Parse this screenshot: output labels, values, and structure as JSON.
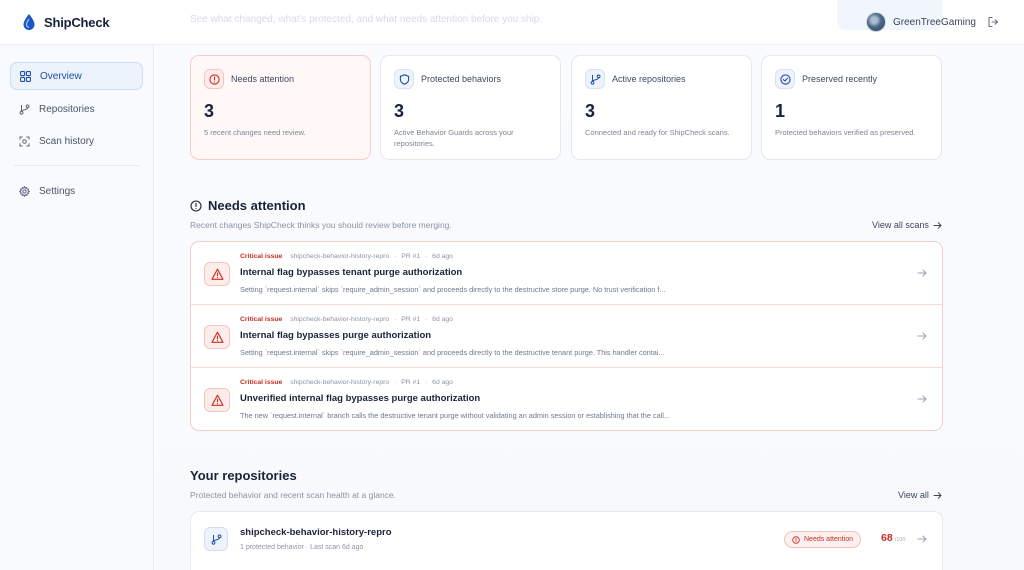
{
  "app": {
    "name": "ShipCheck"
  },
  "header": {
    "subtitle": "See what changed, what's protected, and what needs attention before you ship.",
    "username": "GreenTreeGaming"
  },
  "sidebar": {
    "items": [
      {
        "label": "Overview",
        "icon": "grid-icon",
        "active": true
      },
      {
        "label": "Repositories",
        "icon": "git-branch-icon",
        "active": false
      },
      {
        "label": "Scan history",
        "icon": "scan-icon",
        "active": false
      },
      {
        "label": "Settings",
        "icon": "gear-icon",
        "active": false
      }
    ]
  },
  "stats": [
    {
      "label": "Needs attention",
      "value": "3",
      "desc": "5 recent changes need review.",
      "icon": "alert-circle-icon"
    },
    {
      "label": "Protected behaviors",
      "value": "3",
      "desc": "Active Behavior Guards across your repositories.",
      "icon": "shield-icon"
    },
    {
      "label": "Active repositories",
      "value": "3",
      "desc": "Connected and ready for ShipCheck scans.",
      "icon": "git-branch-icon"
    },
    {
      "label": "Preserved recently",
      "value": "1",
      "desc": "Protected behaviors verified as preserved.",
      "icon": "check-circle-icon"
    }
  ],
  "attention": {
    "title": "Needs attention",
    "subtitle": "Recent changes ShipCheck thinks you should review before merging.",
    "link": "View all scans",
    "issues": [
      {
        "severity": "Critical issue",
        "repo": "shipcheck-behavior-history-repro",
        "pr": "PR #1",
        "time": "6d ago",
        "title": "Internal flag bypasses tenant purge authorization",
        "detail": "Setting `request.internal` skips `require_admin_session` and proceeds directly to the destructive store purge. No trust verification f..."
      },
      {
        "severity": "Critical issue",
        "repo": "shipcheck-behavior-history-repro",
        "pr": "PR #1",
        "time": "6d ago",
        "title": "Internal flag bypasses purge authorization",
        "detail": "Setting `request.internal` skips `require_admin_session` and proceeds directly to the destructive tenant purge. This handler contai..."
      },
      {
        "severity": "Critical issue",
        "repo": "shipcheck-behavior-history-repro",
        "pr": "PR #1",
        "time": "6d ago",
        "title": "Unverified internal flag bypasses purge authorization",
        "detail": "The new `request.internal` branch calls the destructive tenant purge without validating an admin session or establishing that the call..."
      }
    ]
  },
  "repositories": {
    "title": "Your repositories",
    "subtitle": "Protected behavior and recent scan health at a glance.",
    "link": "View all",
    "items": [
      {
        "name": "shipcheck-behavior-history-repro",
        "protected": "1 protected behavior",
        "last_scan": "Last scan 6d ago",
        "status": "Needs attention",
        "score": "68",
        "score_max": "/100"
      }
    ]
  },
  "colors": {
    "accent": "#1d4fa8",
    "danger": "#c62f26",
    "brand": "#1a56c4"
  }
}
